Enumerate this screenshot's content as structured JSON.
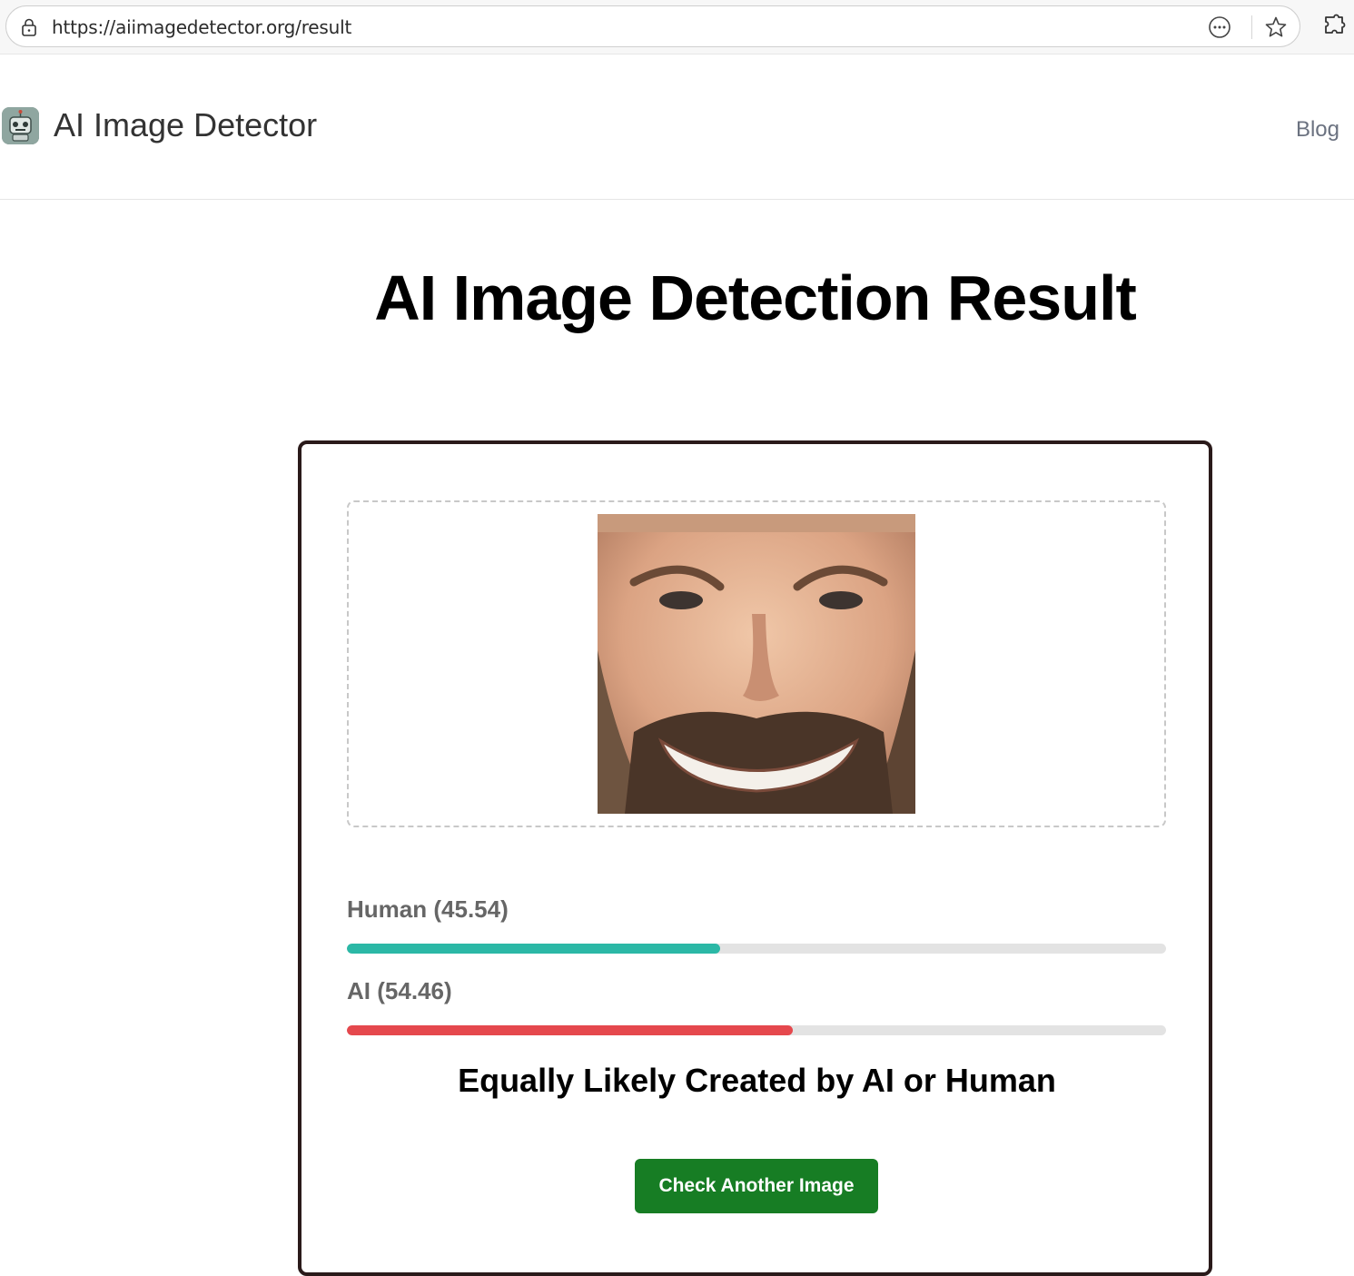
{
  "browser": {
    "url": "https://aiimagedetector.org/result"
  },
  "header": {
    "site_name": "AI Image Detector",
    "nav": [
      {
        "label": "Blog"
      }
    ]
  },
  "main": {
    "title": "AI Image Detection Result",
    "scores": [
      {
        "label": "Human",
        "value_text": "(45.54)",
        "value": 45.54,
        "color": "#2bb8a6"
      },
      {
        "label": "AI",
        "value_text": "(54.46)",
        "value": 54.46,
        "color": "#e5484d"
      }
    ],
    "verdict": "Equally Likely Created by AI or Human",
    "cta_label": "Check Another Image"
  },
  "icons": [
    "lock-icon",
    "more-options-icon",
    "favorite-star-icon",
    "extensions-icon",
    "robot-logo-icon"
  ]
}
